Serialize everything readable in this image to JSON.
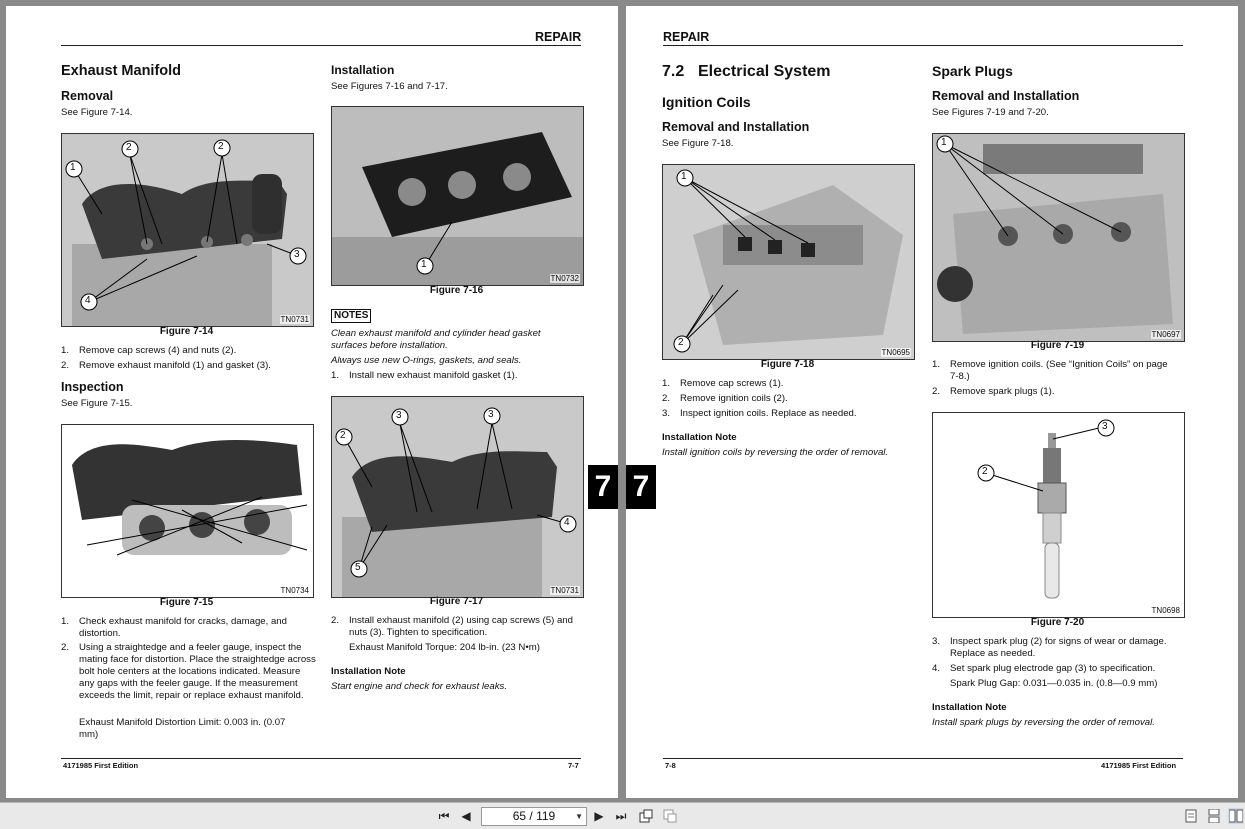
{
  "left_page": {
    "header": "REPAIR",
    "title": "Exhaust Manifold",
    "removal": {
      "heading": "Removal",
      "see": "See Figure 7-14.",
      "figure_code": "TN0731",
      "caption": "Figure 7-14",
      "steps": [
        {
          "n": "1.",
          "text": "Remove cap screws (4) and nuts (2)."
        },
        {
          "n": "2.",
          "text": "Remove exhaust manifold (1) and gasket (3)."
        }
      ]
    },
    "inspection": {
      "heading": "Inspection",
      "see": "See Figure 7-15.",
      "figure_code": "TN0734",
      "caption": "Figure 7-15",
      "steps": [
        {
          "n": "1.",
          "text": "Check exhaust manifold for cracks, damage, and distortion."
        },
        {
          "n": "2.",
          "text": "Using a straightedge and a feeler gauge, inspect the mating face for distortion. Place the straightedge across bolt hole centers at the locations indicated. Measure any gaps with the feeler gauge. If the measurement exceeds the limit, repair or replace exhaust manifold."
        }
      ],
      "spec": "Exhaust Manifold Distortion Limit: 0.003 in. (0.07 mm)"
    },
    "installation": {
      "heading": "Installation",
      "see": "See Figures 7-16 and 7-17.",
      "figure16_code": "TN0732",
      "caption16": "Figure 7-16",
      "notes_label": "NOTES",
      "note1": "Clean exhaust manifold and cylinder head gasket surfaces before installation.",
      "note2": "Always use new O-rings, gaskets, and seals.",
      "step1": {
        "n": "1.",
        "text": "Install new exhaust manifold gasket (1)."
      },
      "figure17_code": "TN0731",
      "caption17": "Figure 7-17",
      "step2": {
        "n": "2.",
        "text": "Install exhaust manifold (2) using cap screws (5) and nuts (3). Tighten to specification."
      },
      "torque": "Exhaust Manifold Torque: 204 lb-in. (23 N•m)",
      "note_heading": "Installation Note",
      "note_text": "Start engine and check for exhaust leaks."
    },
    "footer_left": "4171985 First Edition",
    "footer_right": "7-7",
    "tab": "7"
  },
  "right_page": {
    "header": "REPAIR",
    "section_num": "7.2",
    "section_title": "Electrical System",
    "ignition": {
      "heading": "Ignition Coils",
      "sub": "Removal and Installation",
      "see": "See Figure 7-18.",
      "figure_code": "TN0695",
      "caption": "Figure 7-18",
      "steps": [
        {
          "n": "1.",
          "text": "Remove cap screws (1)."
        },
        {
          "n": "2.",
          "text": "Remove ignition coils (2)."
        },
        {
          "n": "3.",
          "text": "Inspect ignition coils. Replace as needed."
        }
      ],
      "note_heading": "Installation Note",
      "note_text": "Install ignition coils by reversing the order of removal."
    },
    "spark": {
      "heading": "Spark Plugs",
      "sub": "Removal and Installation",
      "see": "See Figures 7-19 and 7-20.",
      "figure19_code": "TN0697",
      "caption19": "Figure 7-19",
      "steps_a": [
        {
          "n": "1.",
          "text": "Remove ignition coils. (See “Ignition Coils” on page 7-8.)"
        },
        {
          "n": "2.",
          "text": "Remove spark plugs (1)."
        }
      ],
      "figure20_code": "TN0698",
      "caption20": "Figure 7-20",
      "steps_b": [
        {
          "n": "3.",
          "text": "Inspect spark plug (2) for signs of wear or damage. Replace as needed."
        },
        {
          "n": "4.",
          "text": "Set spark plug electrode gap (3) to specification."
        }
      ],
      "spec": "Spark Plug Gap: 0.031—0.035 in. (0.8—0.9 mm)",
      "note_heading": "Installation Note",
      "note_text": "Install spark plugs by reversing the order of removal."
    },
    "footer_left": "7-8",
    "footer_right": "4171985 First Edition",
    "tab": "7"
  },
  "callouts": {
    "c1": "1",
    "c2": "2",
    "c3": "3",
    "c4": "4",
    "c5": "5"
  },
  "toolbar": {
    "page_display": "65 / 119",
    "icons": [
      "first-page-icon",
      "prev-page-icon",
      "next-page-icon",
      "last-page-icon",
      "go-back-icon",
      "go-forward-icon",
      "single-page-view-icon",
      "continuous-view-icon",
      "facing-view-icon"
    ]
  }
}
